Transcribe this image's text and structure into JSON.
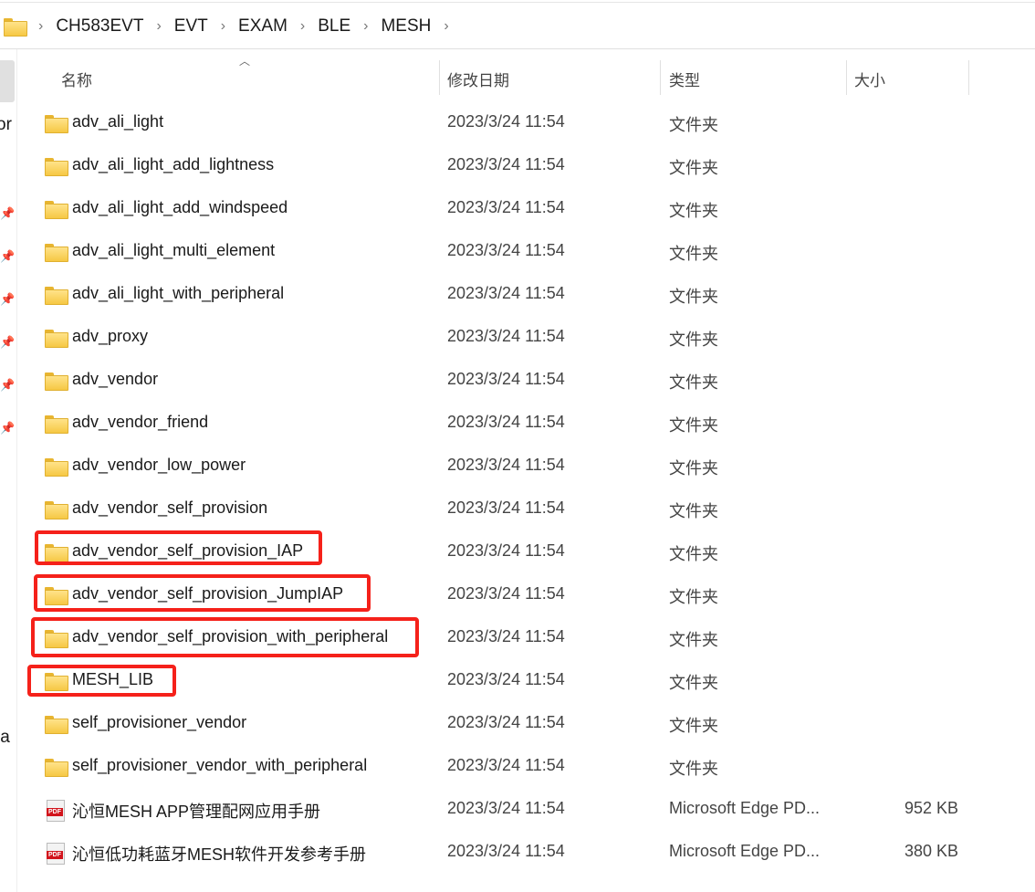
{
  "breadcrumb": [
    "CH583EVT",
    "EVT",
    "EXAM",
    "BLE",
    "MESH"
  ],
  "nav_pane_fragments": [
    "or",
    "la"
  ],
  "columns": {
    "name": "名称",
    "modified": "修改日期",
    "type": "类型",
    "size": "大小"
  },
  "files": [
    {
      "name": "adv_ali_light",
      "modified": "2023/3/24 11:54",
      "type": "文件夹",
      "size": "",
      "icon": "folder-icon"
    },
    {
      "name": "adv_ali_light_add_lightness",
      "modified": "2023/3/24 11:54",
      "type": "文件夹",
      "size": "",
      "icon": "folder-icon"
    },
    {
      "name": "adv_ali_light_add_windspeed",
      "modified": "2023/3/24 11:54",
      "type": "文件夹",
      "size": "",
      "icon": "folder-icon"
    },
    {
      "name": "adv_ali_light_multi_element",
      "modified": "2023/3/24 11:54",
      "type": "文件夹",
      "size": "",
      "icon": "folder-icon"
    },
    {
      "name": "adv_ali_light_with_peripheral",
      "modified": "2023/3/24 11:54",
      "type": "文件夹",
      "size": "",
      "icon": "folder-icon"
    },
    {
      "name": "adv_proxy",
      "modified": "2023/3/24 11:54",
      "type": "文件夹",
      "size": "",
      "icon": "folder-icon"
    },
    {
      "name": "adv_vendor",
      "modified": "2023/3/24 11:54",
      "type": "文件夹",
      "size": "",
      "icon": "folder-icon"
    },
    {
      "name": "adv_vendor_friend",
      "modified": "2023/3/24 11:54",
      "type": "文件夹",
      "size": "",
      "icon": "folder-icon"
    },
    {
      "name": "adv_vendor_low_power",
      "modified": "2023/3/24 11:54",
      "type": "文件夹",
      "size": "",
      "icon": "folder-icon"
    },
    {
      "name": "adv_vendor_self_provision",
      "modified": "2023/3/24 11:54",
      "type": "文件夹",
      "size": "",
      "icon": "folder-icon"
    },
    {
      "name": "adv_vendor_self_provision_IAP",
      "modified": "2023/3/24 11:54",
      "type": "文件夹",
      "size": "",
      "icon": "folder-icon",
      "highlighted": true
    },
    {
      "name": "adv_vendor_self_provision_JumpIAP",
      "modified": "2023/3/24 11:54",
      "type": "文件夹",
      "size": "",
      "icon": "folder-icon",
      "highlighted": true
    },
    {
      "name": "adv_vendor_self_provision_with_peripheral",
      "modified": "2023/3/24 11:54",
      "type": "文件夹",
      "size": "",
      "icon": "folder-icon",
      "highlighted": true
    },
    {
      "name": "MESH_LIB",
      "modified": "2023/3/24 11:54",
      "type": "文件夹",
      "size": "",
      "icon": "folder-icon",
      "highlighted": true
    },
    {
      "name": "self_provisioner_vendor",
      "modified": "2023/3/24 11:54",
      "type": "文件夹",
      "size": "",
      "icon": "folder-icon"
    },
    {
      "name": "self_provisioner_vendor_with_peripheral",
      "modified": "2023/3/24 11:54",
      "type": "文件夹",
      "size": "",
      "icon": "folder-icon"
    },
    {
      "name": "沁恒MESH APP管理配网应用手册",
      "modified": "2023/3/24 11:54",
      "type": "Microsoft Edge PD...",
      "size": "952 KB",
      "icon": "pdf-icon"
    },
    {
      "name": "沁恒低功耗蓝牙MESH软件开发参考手册",
      "modified": "2023/3/24 11:54",
      "type": "Microsoft Edge PD...",
      "size": "380 KB",
      "icon": "pdf-icon"
    }
  ],
  "pdf_icon_label": "PDF",
  "highlight_color": "#f5211a"
}
